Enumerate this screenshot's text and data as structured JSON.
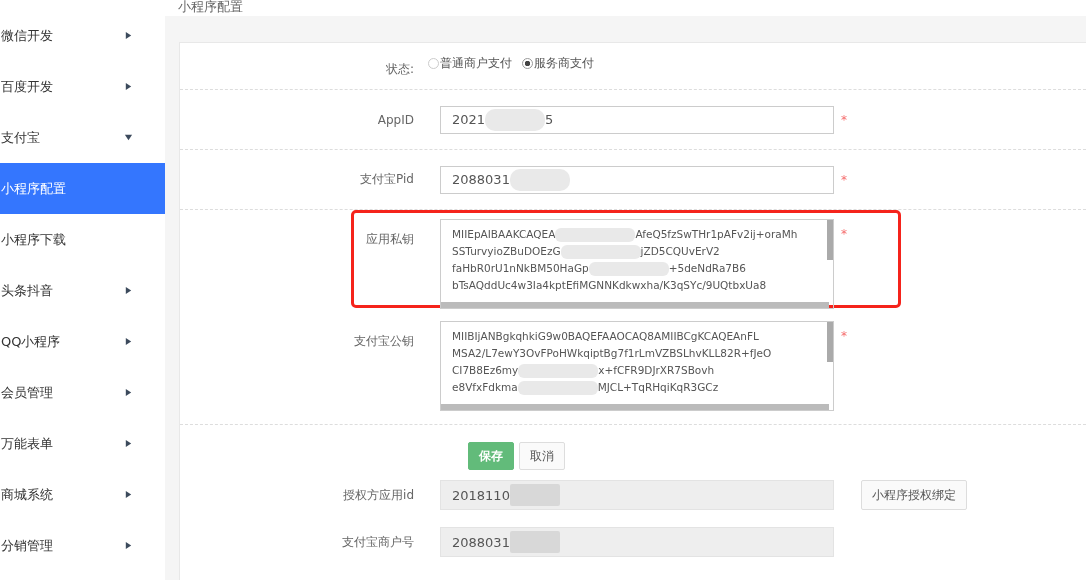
{
  "page_title": "小程序配置",
  "sidebar": {
    "items": [
      {
        "label": "微信开发",
        "expanded": false,
        "selected": false,
        "kind": "group"
      },
      {
        "label": "百度开发",
        "expanded": false,
        "selected": false,
        "kind": "group"
      },
      {
        "label": "支付宝",
        "expanded": true,
        "selected": false,
        "kind": "group"
      },
      {
        "label": "小程序配置",
        "selected": true,
        "kind": "link"
      },
      {
        "label": "小程序下载",
        "selected": false,
        "kind": "link"
      },
      {
        "label": "头条抖音",
        "expanded": false,
        "selected": false,
        "kind": "group"
      },
      {
        "label": "QQ小程序",
        "expanded": false,
        "selected": false,
        "kind": "group"
      },
      {
        "label": "会员管理",
        "expanded": false,
        "selected": false,
        "kind": "group"
      },
      {
        "label": "万能表单",
        "expanded": false,
        "selected": false,
        "kind": "group"
      },
      {
        "label": "商城系统",
        "expanded": false,
        "selected": false,
        "kind": "group"
      },
      {
        "label": "分销管理",
        "expanded": false,
        "selected": false,
        "kind": "group"
      }
    ]
  },
  "form": {
    "status": {
      "label": "状态:",
      "options": [
        {
          "label": "普通商户支付",
          "selected": false
        },
        {
          "label": "服务商支付",
          "selected": true
        }
      ]
    },
    "fields": [
      {
        "kind": "input",
        "label": "AppID",
        "required_mark": "*",
        "value_start": "2021",
        "value_end": "5"
      },
      {
        "kind": "input",
        "label": "支付宝Pid",
        "required_mark": "*",
        "value_start": "2088031"
      },
      {
        "kind": "textarea",
        "label": "应用私钥",
        "required_mark": "*",
        "highlighted": true,
        "lines": [
          {
            "start": "MIIEpAIBAAKCAQEA",
            "end": "AfeQ5fzSwTHr1pAFv2ij+oraMh"
          },
          {
            "start": "SSTurvyioZBuDOEzG",
            "end": "jZD5CQUvErV2"
          },
          {
            "start": "faHbR0rU1nNkBM50HaGp",
            "end": "+5deNdRa7B6"
          },
          {
            "start": "bTsAQddUc4w3Ia4kptEfiMGNNKdkwxha/K3qSYc/9UQtbxUa8"
          }
        ]
      },
      {
        "kind": "textarea",
        "label": "支付宝公钥",
        "required_mark": "*",
        "lines": [
          {
            "start": "MIIBIjANBgkqhkiG9w0BAQEFAAOCAQ8AMIIBCgKCAQEAnFL"
          },
          {
            "start": "MSA2/L7ewY3OvFPoHWkqiptBg7f1rLmVZBSLhvKLL82R+fJeO"
          },
          {
            "start": "CI7B8Ez6my",
            "end": "x+fCFR9DJrXR7SBovh"
          },
          {
            "start": "e8VfxFdkma",
            "end": "MJCL+TqRHqiKqR3GCz"
          }
        ]
      }
    ],
    "buttons": [
      {
        "label": "保存",
        "kind": "primary"
      },
      {
        "label": "取消",
        "kind": "default"
      }
    ],
    "readonly_fields": [
      {
        "label": "授权方应用id",
        "value_start": "2018110",
        "action": "小程序授权绑定"
      },
      {
        "label": "支付宝商户号",
        "value_start": "2088031"
      }
    ]
  }
}
